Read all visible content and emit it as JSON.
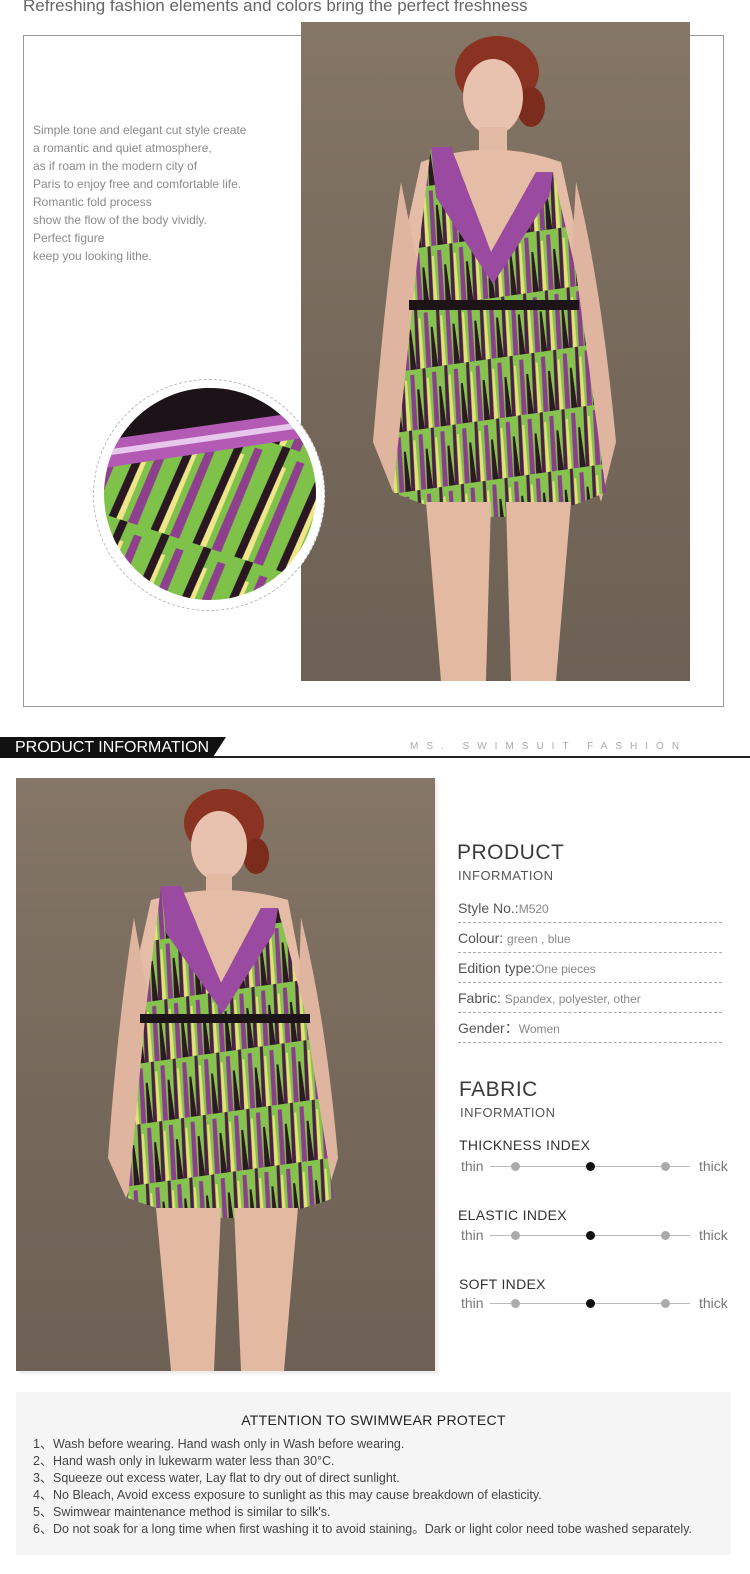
{
  "top": {
    "heading": "Refreshing fashion elements and colors bring the perfect freshness",
    "description": [
      "Simple tone and elegant cut style create",
      "a romantic and quiet atmosphere,",
      "as if roam in the modern city of",
      "Paris to enjoy free and comfortable life.",
      "Romantic fold process",
      "show the flow of the body vividly.",
      "Perfect figure",
      "keep you looking  lithe."
    ]
  },
  "band": {
    "label": "PRODUCT INFORMATION",
    "tagline": "MS. SWIMSUIT FASHION"
  },
  "product": {
    "title": "PRODUCT",
    "subtitle": "INFORMATION",
    "specs": [
      {
        "label": "Style No.:",
        "value": "M520"
      },
      {
        "label": "Colour: ",
        "value": "green , blue"
      },
      {
        "label": "Edition type:",
        "value": "One pieces"
      },
      {
        "label": "Fabric: ",
        "value": "Spandex, polyester, other"
      },
      {
        "label": "Gender：",
        "value": "Women"
      }
    ]
  },
  "fabric": {
    "title": "FABRIC",
    "subtitle": "INFORMATION",
    "left_label": "thin",
    "right_label": "thick",
    "indices": [
      {
        "name": "THICKNESS INDEX",
        "level": 2
      },
      {
        "name": "ELASTIC INDEX",
        "level": 2
      },
      {
        "name": "SOFT INDEX",
        "level": 2
      }
    ],
    "scale_points": 3
  },
  "notice": {
    "title": "ATTENTION TO SWIMWEAR PROTECT",
    "items": [
      {
        "num": "1、",
        "text": "Wash before wearing. Hand wash only in Wash before wearing."
      },
      {
        "num": "2、",
        "text": "Hand wash only in lukewarm water less than 30°C."
      },
      {
        "num": "3、",
        "text": "Squeeze out excess water, Lay flat to dry out of direct sunlight."
      },
      {
        "num": "4、",
        "text": "No Bleach, Avoid excess exposure to sunlight as this may cause breakdown of elasticity."
      },
      {
        "num": "5、",
        "text": "Swimwear maintenance method is similar to silk's."
      },
      {
        "num": "6、",
        "text": "Do not soak for a long time when first washing it to avoid staining。Dark or light color need tobe washed separately."
      }
    ]
  },
  "colors": {
    "accent": "#111111",
    "dress_green": "#7ec24a",
    "dress_purple": "#6b2a6a",
    "backdrop": "#7d6f61"
  }
}
